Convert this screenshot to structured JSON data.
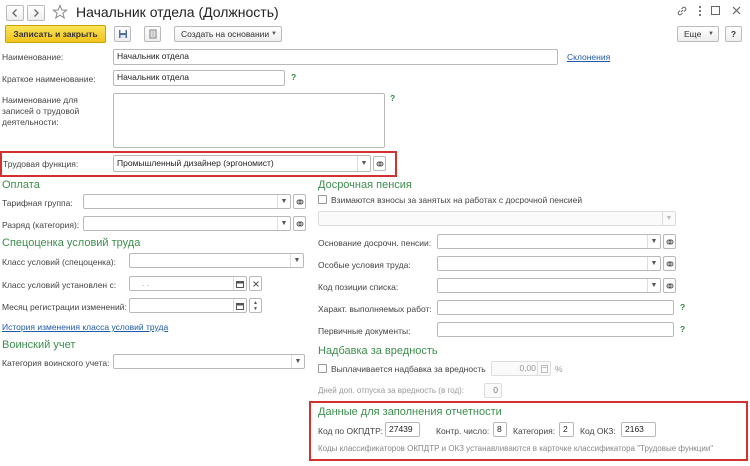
{
  "window": {
    "title": "Начальник отдела (Должность)"
  },
  "toolbar": {
    "save_close": "Записать и закрыть",
    "create_based": "Создать на основании",
    "more": "Еще",
    "help": "?"
  },
  "fields": {
    "name_label": "Наименование:",
    "name_value": "Начальник отдела",
    "declension_link": "Склонения",
    "short_label": "Краткое наименование:",
    "short_value": "Начальник отдела",
    "labor_label": "Наименование для записей о трудовой деятельности:",
    "labor_func_label": "Трудовая функция:",
    "labor_func_value": "Промышленный дизайнер (эргономист)"
  },
  "payment": {
    "title": "Оплата",
    "tariff_label": "Тарифная группа:",
    "grade_label": "Разряд (категория):"
  },
  "special": {
    "title": "Спецоценка условий труда",
    "class_label": "Класс условий (спецоценка):",
    "set_from_label": "Класс условий установлен с:",
    "set_from_value": ". .",
    "month_label": "Месяц регистрации изменений:",
    "history_link": "История изменения класса условий труда"
  },
  "military": {
    "title": "Воинский учет",
    "category_label": "Категория воинского учета:"
  },
  "pension": {
    "title": "Досрочная пенсия",
    "contrib_label": "Взимаются взносы за занятых на работах с досрочной пенсией",
    "basis_label": "Основание досрочн. пенсии:",
    "special_cond_label": "Особые условия труда:",
    "code_label": "Код позиции списка:",
    "work_label": "Характ. выполняемых работ:",
    "docs_label": "Первичные документы:"
  },
  "harm": {
    "title": "Надбавка за вредность",
    "paid_label": "Выплачивается надбавка за вредность",
    "paid_value": "0,00",
    "percent": "%",
    "days_label": "Дней доп. отпуска за вредность (в год):",
    "days_value": "0"
  },
  "report": {
    "title": "Данные для заполнения отчетности",
    "okpdtr_label": "Код по ОКПДТР:",
    "okpdtr_value": "27439",
    "control_label": "Контр. число:",
    "control_value": "8",
    "category_label": "Категория:",
    "category_value": "2",
    "okz_label": "Код ОКЗ:",
    "okz_value": "2163",
    "note": "Коды классификаторов ОКПДТР и ОКЗ устанавливаются в карточке классификатора \"Трудовые функции\""
  }
}
